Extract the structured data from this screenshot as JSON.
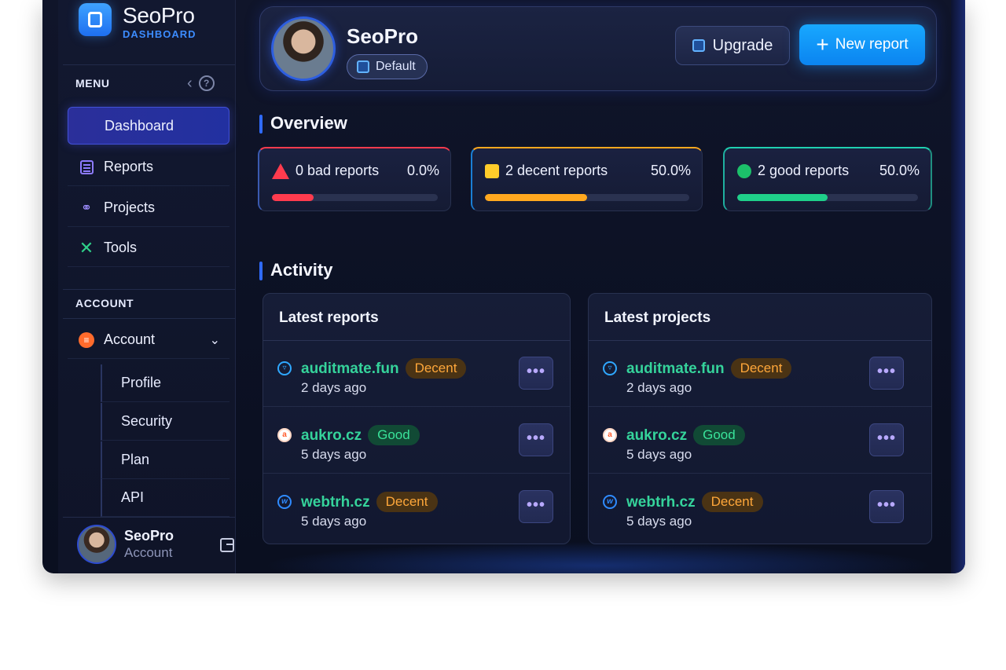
{
  "brand": {
    "name": "SeoPro",
    "subtitle": "DASHBOARD"
  },
  "sidebar": {
    "menu_label": "MENU",
    "items": [
      {
        "label": "Dashboard",
        "icon": "dashboard-icon",
        "active": true
      },
      {
        "label": "Reports",
        "icon": "reports-icon"
      },
      {
        "label": "Projects",
        "icon": "projects-icon"
      },
      {
        "label": "Tools",
        "icon": "tools-icon"
      }
    ],
    "account_label": "ACCOUNT",
    "account_item": {
      "label": "Account",
      "icon": "account-icon",
      "expanded": true
    },
    "sub_items": [
      "Profile",
      "Security",
      "Plan",
      "API"
    ],
    "user": {
      "name": "SeoPro",
      "role": "Account"
    }
  },
  "header": {
    "title": "SeoPro",
    "badge": "Default",
    "upgrade_label": "Upgrade",
    "new_report_label": "New report"
  },
  "overview": {
    "title": "Overview",
    "stats": [
      {
        "label": "0 bad reports",
        "percent_text": "0.0%",
        "percent": 0.0,
        "color": "#ff3b4e",
        "icon": "warning-triangle-icon"
      },
      {
        "label": "2 decent reports",
        "percent_text": "50.0%",
        "percent": 50.0,
        "color": "#ffa81f",
        "icon": "yellow-square-icon"
      },
      {
        "label": "2 good reports",
        "percent_text": "50.0%",
        "percent": 50.0,
        "color": "#1fd08a",
        "icon": "green-dot-icon"
      }
    ]
  },
  "activity": {
    "title": "Activity",
    "latest_reports": {
      "title": "Latest reports",
      "rows": [
        {
          "site": "auditmate.fun",
          "status": "Decent",
          "time": "2 days ago"
        },
        {
          "site": "aukro.cz",
          "status": "Good",
          "time": "5 days ago"
        },
        {
          "site": "webtrh.cz",
          "status": "Decent",
          "time": "5 days ago"
        }
      ]
    },
    "latest_projects": {
      "title": "Latest projects",
      "rows": [
        {
          "site": "auditmate.fun",
          "status": "Decent",
          "time": "2 days ago"
        },
        {
          "site": "aukro.cz",
          "status": "Good",
          "time": "5 days ago"
        },
        {
          "site": "webtrh.cz",
          "status": "Decent",
          "time": "5 days ago"
        }
      ]
    },
    "more_label": "•••"
  }
}
